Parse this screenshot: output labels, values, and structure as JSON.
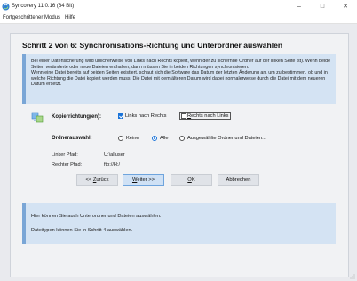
{
  "window": {
    "title": "Syncovery 11.0.16 (64 Bit)",
    "minimize": "–",
    "maximize": "□",
    "close": "✕"
  },
  "menu": [
    {
      "label": "Fortgeschrittener Modus"
    },
    {
      "label": "Hilfe"
    }
  ],
  "page": {
    "heading": "Schritt 2 von 6: Synchronisations-Richtung und Unterordner auswählen",
    "info_para1": "Bei einer Datensicherung wird üblicherweise von Links nach Rechts kopiert, wenn der zu sichernde Ordner auf der linken Seite ist). Wenn beide Seiten veränderte oder neue Dateien enthalten, dann müssen Sie in beiden Richtungen synchronisieren.",
    "info_para2": "Wenn eine Datei bereits auf beiden Seiten existiert, schaut sich die Software das Datum der letzten Änderung an, um zu bestimmen, ob und in welche Richtung die Datei kopiert werden muss. Die Datei mit dem älteren Datum wird dabei normalerweise durch die Datei mit dem neueren Datum ersetzt."
  },
  "copy_direction": {
    "label": "Kopierrichtung(en):",
    "left_to_right": {
      "label": "Links nach Rechts",
      "checked": true
    },
    "right_to_left": {
      "label": "Rechts nach Links",
      "checked": false
    }
  },
  "folder_selection": {
    "label": "Ordnerauswahl:",
    "options": [
      {
        "label": "Keine",
        "selected": false
      },
      {
        "label": "Alle",
        "selected": true
      },
      {
        "label": "Ausgewählte Ordner und Dateien...",
        "selected": false
      }
    ]
  },
  "paths": {
    "left_label": "Linker Pfad:",
    "left_value": "U:\\alluser",
    "right_label": "Rechter Pfad:",
    "right_value": "ftp://H:/"
  },
  "buttons": {
    "back": "<< Zurück",
    "next": "Weiter >>",
    "ok": "OK",
    "cancel": "Abbrechen"
  },
  "bottom_info": {
    "line1": "Hier können Sie auch Unterordner und Dateien auswählen.",
    "line2": "Dateitypen können Sie in Schritt 4 auswählen."
  },
  "colors": {
    "accent": "#1a73d9",
    "info_bg": "#d4e3f3",
    "info_bar": "#7aa6d6"
  }
}
